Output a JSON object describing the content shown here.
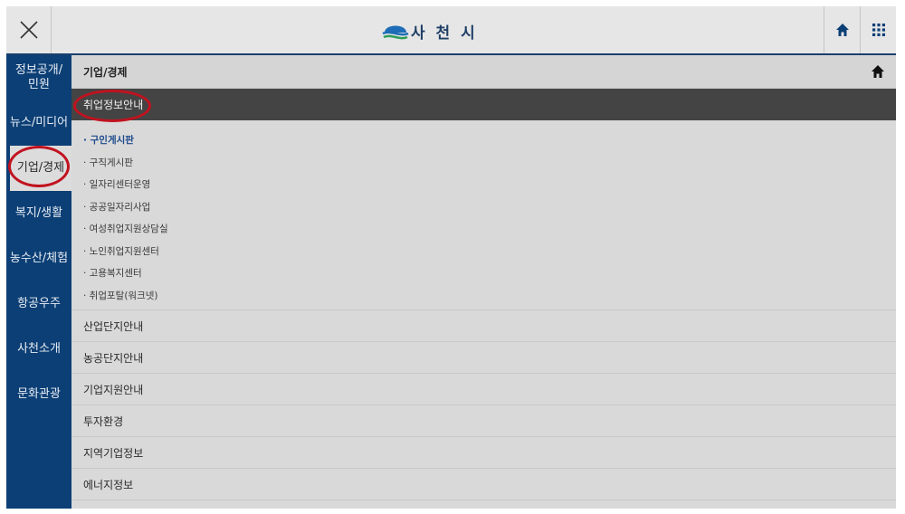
{
  "header": {
    "logo_text": "사 천 시",
    "close_icon": "close-icon",
    "home_icon": "home-icon",
    "grid_icon": "grid-menu-icon"
  },
  "sidebar": {
    "items": [
      {
        "label": "정보공개/민원"
      },
      {
        "label": "뉴스/미디어"
      },
      {
        "label": "기업/경제"
      },
      {
        "label": "복지/생활"
      },
      {
        "label": "농수산/체험"
      },
      {
        "label": "항공우주"
      },
      {
        "label": "사천소개"
      },
      {
        "label": "문화관광"
      }
    ],
    "active_index": 2
  },
  "content": {
    "breadcrumb": "기업/경제",
    "section_title": "취업정보안내",
    "subitems": [
      "· 구인게시판",
      "· 구직게시판",
      "· 일자리센터운영",
      "· 공공일자리사업",
      "· 여성취업지원상담실",
      "· 노인취업지원센터",
      "· 고용복지센터",
      "· 취업포탈(워크넷)"
    ],
    "menu": [
      "산업단지안내",
      "농공단지안내",
      "기업지원안내",
      "투자환경",
      "지역기업정보",
      "에너지정보"
    ]
  },
  "colors": {
    "navy": "#0c3f75",
    "highlight_ring": "#c1121f",
    "section_bg": "#444444"
  }
}
